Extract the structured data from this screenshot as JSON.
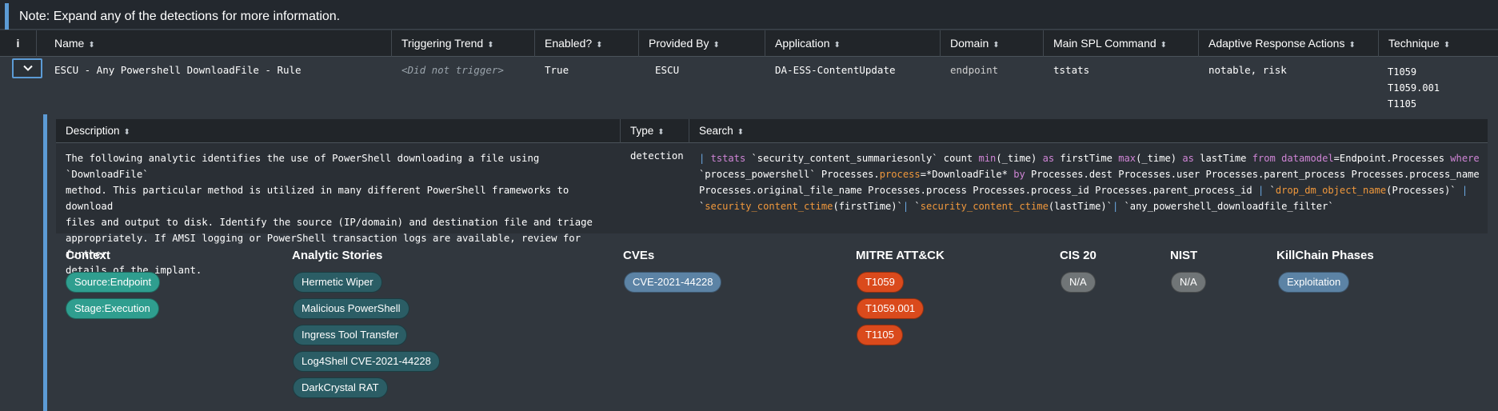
{
  "note": "Note: Expand any of the detections for more information.",
  "headers": {
    "info": "i",
    "name": "Name",
    "trend": "Triggering Trend",
    "enabled": "Enabled?",
    "provided": "Provided By",
    "application": "Application",
    "domain": "Domain",
    "spl": "Main SPL Command",
    "ara": "Adaptive Response Actions",
    "technique": "Technique"
  },
  "row": {
    "name": "ESCU - Any Powershell DownloadFile - Rule",
    "trend": "<Did not trigger>",
    "enabled": "True",
    "provided": "ESCU",
    "application": "DA-ESS-ContentUpdate",
    "domain": "endpoint",
    "spl": "tstats",
    "ara": "notable, risk",
    "techniques": [
      "T1059",
      "T1059.001",
      "T1105"
    ]
  },
  "details": {
    "headers": {
      "description": "Description",
      "type": "Type",
      "search": "Search"
    },
    "description_lines": [
      "The following analytic identifies the use of PowerShell downloading a file using `DownloadFile`",
      "method. This particular method is utilized in many different PowerShell frameworks to download",
      "files and output to disk. Identify the source (IP/domain) and destination file and triage",
      "appropriately. If AMSI logging or PowerShell transaction logs are available, review for further",
      "details of the implant."
    ],
    "type": "detection",
    "search": {
      "l1_pipe": "| ",
      "l1_tstats": "tstats",
      "l1_a": " `security_content_summariesonly` count ",
      "l1_min": "min",
      "l1_b": "(_time) ",
      "l1_as1": "as",
      "l1_c": " firstTime ",
      "l1_max": "max",
      "l1_d": "(_time) ",
      "l1_as2": "as",
      "l1_e": " lastTime ",
      "l1_from": "from",
      "l1_f": " ",
      "l1_dm": "datamodel",
      "l1_g": "=Endpoint.Processes ",
      "l1_where": "where",
      "l2_a": "`process_powershell` Processes.",
      "l2_process": "process",
      "l2_b": "=*DownloadFile* ",
      "l2_by": "by",
      "l2_c": " Processes.dest Processes.user Processes.parent_process Processes.process_name",
      "l3_a": "Processes.original_file_name Processes.process Processes.process_id Processes.parent_process_id ",
      "l3_pipe": "|",
      "l3_b": " `",
      "l3_macro": "drop_dm_object_name",
      "l3_c": "(Processes)` ",
      "l3_pipe2": "|",
      "l4_a": "`",
      "l4_ctime1": "security_content_ctime",
      "l4_b": "(firstTime)`",
      "l4_pipe": "|",
      "l4_c": " `",
      "l4_ctime2": "security_content_ctime",
      "l4_d": "(lastTime)`",
      "l4_pipe2": "|",
      "l4_e": " `any_powershell_downloadfile_filter`"
    }
  },
  "sections": {
    "context": {
      "title": "Context",
      "items": [
        "Source:Endpoint",
        "Stage:Execution"
      ]
    },
    "stories": {
      "title": "Analytic Stories",
      "items": [
        "Hermetic Wiper",
        "Malicious PowerShell",
        "Ingress Tool Transfer",
        "Log4Shell CVE-2021-44228",
        "DarkCrystal RAT"
      ]
    },
    "cves": {
      "title": "CVEs",
      "items": [
        "CVE-2021-44228"
      ]
    },
    "mitre": {
      "title": "MITRE ATT&CK",
      "items": [
        "T1059",
        "T1059.001",
        "T1105"
      ]
    },
    "cis": {
      "title": "CIS 20",
      "items": [
        "N/A"
      ]
    },
    "nist": {
      "title": "NIST",
      "items": [
        "N/A"
      ]
    },
    "killchain": {
      "title": "KillChain Phases",
      "items": [
        "Exploitation"
      ]
    }
  },
  "colors": {
    "accent": "#5c9bd5",
    "context_pill": "#2f9e8f",
    "story_pill": "#2b5d65",
    "cve_pill": "#5c83a5",
    "mitre_pill": "#da4a1c",
    "na_pill": "#707577"
  },
  "icons": {
    "expand": "chevron-down-icon",
    "sort": "sort-arrows-icon"
  }
}
